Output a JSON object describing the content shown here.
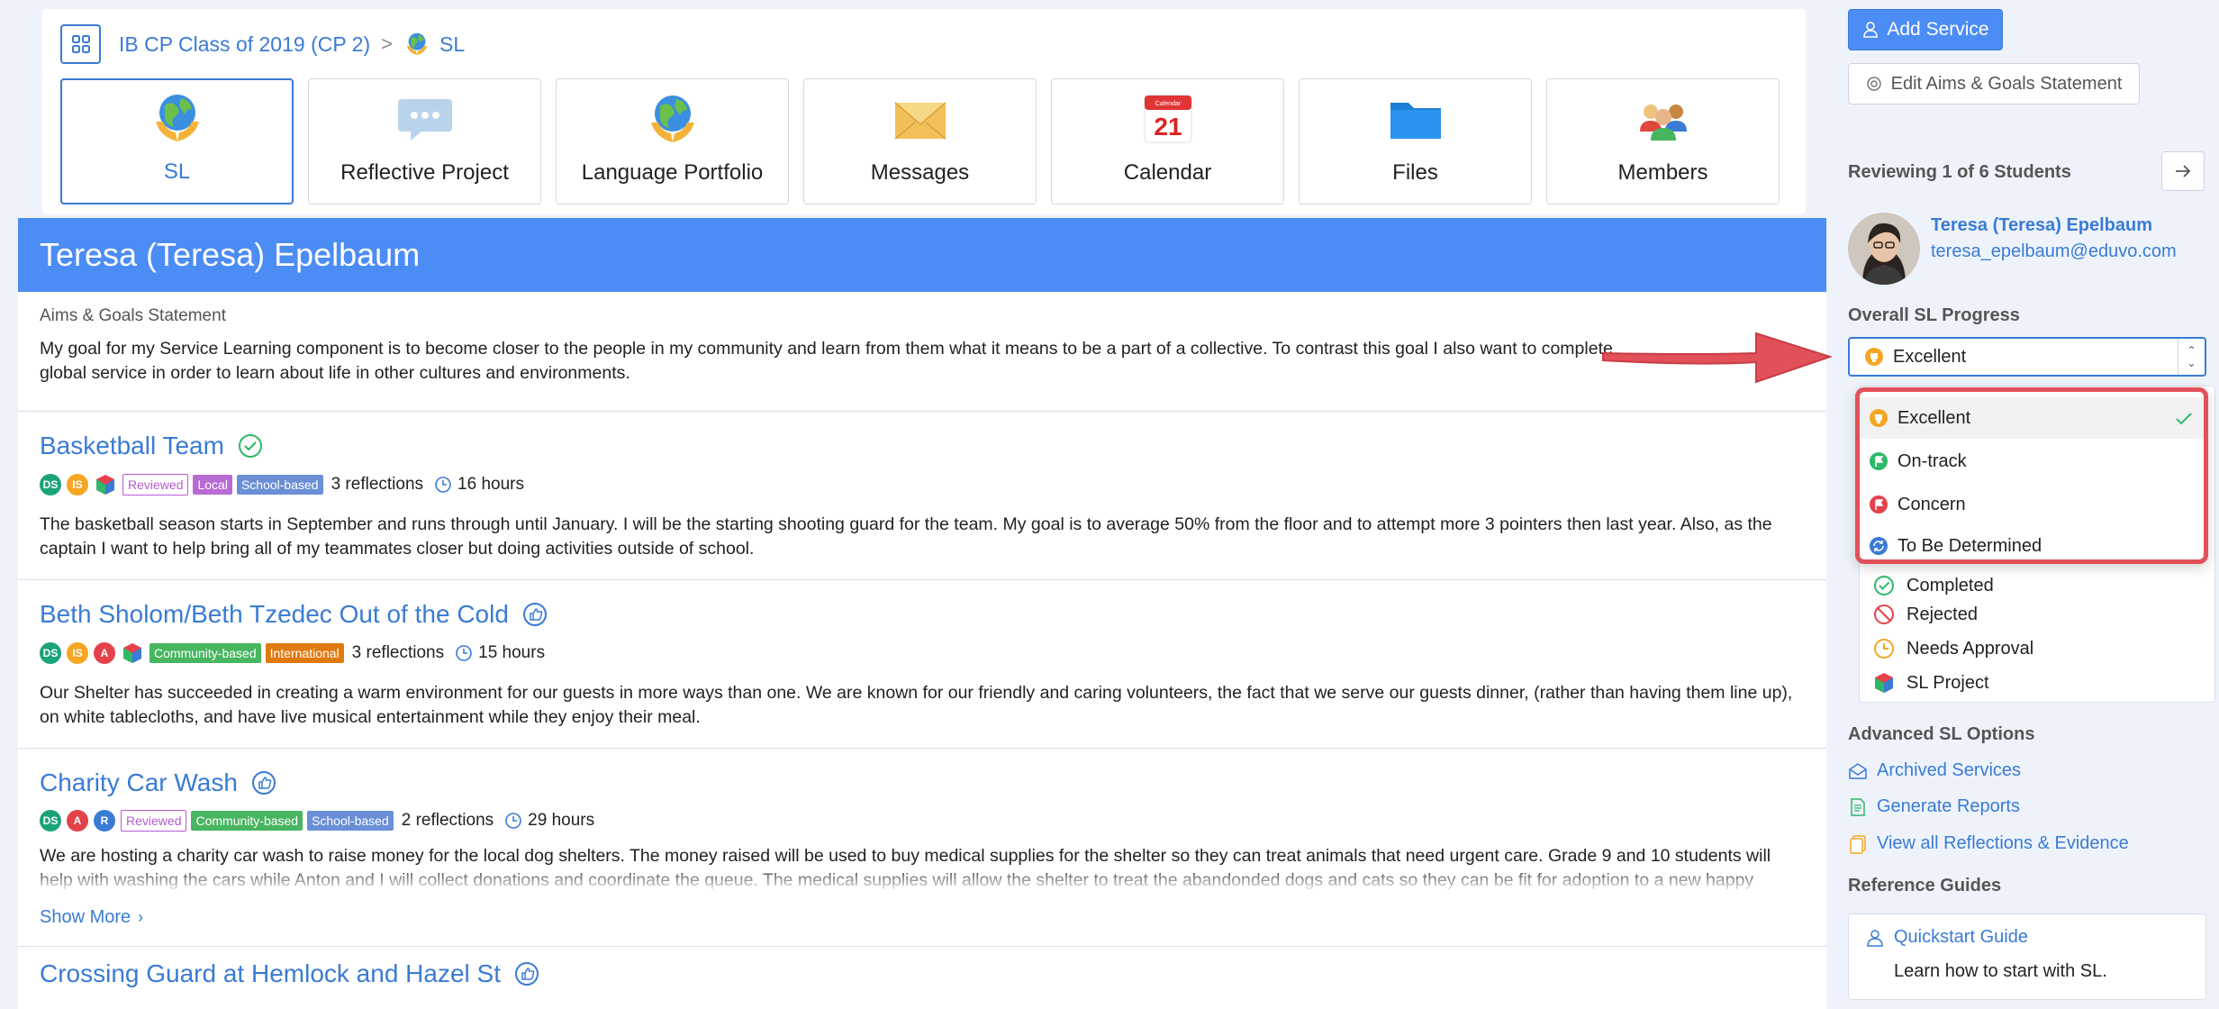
{
  "breadcrumb": {
    "class_name": "IB CP Class of 2019 (CP 2)",
    "separator": ">",
    "current": "SL"
  },
  "tabs": [
    {
      "label": "SL",
      "icon": "globe-hands-icon",
      "active": true
    },
    {
      "label": "Reflective Project",
      "icon": "speech-bubble-icon",
      "active": false
    },
    {
      "label": "Language Portfolio",
      "icon": "globe-hands-icon",
      "active": false
    },
    {
      "label": "Messages",
      "icon": "envelope-icon",
      "active": false
    },
    {
      "label": "Calendar",
      "icon": "calendar-icon",
      "active": false
    },
    {
      "label": "Files",
      "icon": "folder-icon",
      "active": false
    },
    {
      "label": "Members",
      "icon": "people-icon",
      "active": false
    }
  ],
  "calendar_day": "21",
  "calendar_month": "Calendar",
  "student": {
    "name": "Teresa (Teresa) Epelbaum",
    "aims_title": "Aims & Goals Statement",
    "aims_text": "My goal for my Service Learning component is to become closer to the people in my community and learn from them what it means to be a part of a collective. To contrast this goal I also want to complete global service in order to learn about life in other cultures and environments."
  },
  "services": [
    {
      "title": "Basketball Team",
      "status_icon": "check-circle-icon",
      "avatars": [
        "DS",
        "IS"
      ],
      "tags": [
        "Reviewed",
        "Local",
        "School-based"
      ],
      "reflections": "3 reflections",
      "hours": "16 hours",
      "description": "The basketball season starts in September and runs through until January. I will be the starting shooting guard for the team. My goal is to average 50% from the floor and to attempt more 3 pointers then last year. Also, as the captain I want to help bring all of my teammates closer but doing activities outside of school."
    },
    {
      "title": "Beth Sholom/Beth Tzedec Out of the Cold",
      "status_icon": "thumbs-up-icon",
      "avatars": [
        "DS",
        "IS",
        "A"
      ],
      "tags": [
        "Community-based",
        "International"
      ],
      "reflections": "3 reflections",
      "hours": "15 hours",
      "description": "Our Shelter has succeeded in creating a warm environment for our guests in more ways than one. We are known for our friendly and caring volunteers, the fact that we serve our guests dinner, (rather than having them line up), on white tablecloths, and have live musical entertainment while they enjoy their meal."
    },
    {
      "title": "Charity Car Wash",
      "status_icon": "thumbs-up-icon",
      "avatars": [
        "DS",
        "A",
        "R"
      ],
      "tags": [
        "Reviewed",
        "Community-based",
        "School-based"
      ],
      "reflections": "2 reflections",
      "hours": "29 hours",
      "description": "We are hosting a charity car wash to raise money for the local dog shelters. The money raised will be used to buy medical supplies for the shelter so they can treat animals that need urgent care. Grade 9 and 10 students will help with washing the cars while Anton and I will collect donations and coordinate the queue. The medical supplies will allow the shelter to treat the abandonded dogs and cats so they can be fit for adoption to a new happy family.",
      "show_more": "Show More"
    },
    {
      "title": "Crossing Guard at Hemlock and Hazel St",
      "status_icon": "thumbs-up-icon"
    }
  ],
  "sidebar": {
    "add_service": "Add Service",
    "edit_aims": "Edit Aims & Goals Statement",
    "reviewing": "Reviewing 1 of 6 Students",
    "profile_name": "Teresa (Teresa) Epelbaum",
    "profile_email": "teresa_epelbaum@eduvo.com",
    "progress_label": "Overall SL Progress",
    "progress_value": "Excellent",
    "dropdown_options": [
      "Excellent",
      "On-track",
      "Concern",
      "To Be Determined"
    ],
    "legend": [
      "Completed",
      "Rejected",
      "Needs Approval",
      "SL Project"
    ],
    "advanced_label": "Advanced SL Options",
    "advanced_links": [
      "Archived Services",
      "Generate Reports",
      "View all Reflections & Evidence"
    ],
    "guides_label": "Reference Guides",
    "guide_link": "Quickstart Guide",
    "guide_text": "Learn how to start with SL."
  },
  "colors": {
    "accent": "#3a7bd5",
    "banner": "#4c8cf5",
    "excellent": "#f5a623",
    "on_track": "#2fb86a",
    "concern": "#e5414b",
    "tbd": "#3a7bd5",
    "annotation": "#e2505a"
  }
}
